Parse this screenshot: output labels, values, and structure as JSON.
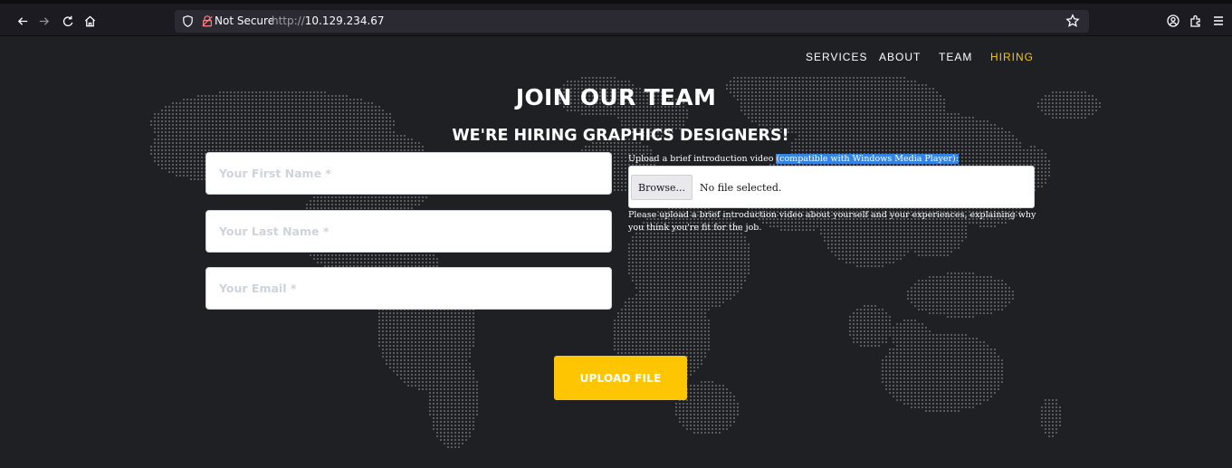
{
  "browser": {
    "not_secure_label": "Not Secure",
    "url_scheme": "http://",
    "url_host": "10.129.234.67",
    "icons": [
      "back-arrow-icon",
      "forward-arrow-icon",
      "reload-icon",
      "home-icon",
      "shield-icon",
      "insecure-lock-icon",
      "star-icon",
      "account-icon",
      "extensions-icon",
      "menu-icon"
    ]
  },
  "nav": {
    "items": [
      {
        "label": "SERVICES"
      },
      {
        "label": "ABOUT"
      },
      {
        "label": "TEAM"
      },
      {
        "label": "HIRING"
      }
    ],
    "active": "HIRING"
  },
  "hero": {
    "title": "JOIN OUR TEAM",
    "subtitle": "WE'RE HIRING GRAPHICS DESIGNERS!"
  },
  "form": {
    "first_name_placeholder": "Your First Name *",
    "last_name_placeholder": "Your Last Name *",
    "email_placeholder": "Your Email *",
    "upload_label_prefix": "Upload a brief introduction video ",
    "upload_label_highlight": "(compatible with Windows Media Player)",
    "upload_label_suffix": ":",
    "browse_label": "Browse...",
    "file_status": "No file selected.",
    "upload_help": "Please upload a brief introduction video about yourself and your experiences, explaining why you think you're fit for the job.",
    "submit_label": "UPLOAD FILE"
  },
  "colors": {
    "accent": "#fec503",
    "page_background": "#1e2024",
    "selection": "#3584e4"
  }
}
